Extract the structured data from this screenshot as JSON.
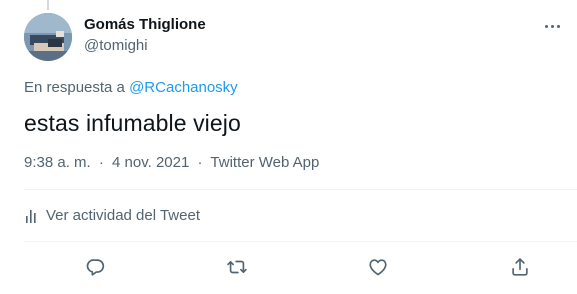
{
  "author": {
    "display_name": "Gomás Thiglione",
    "handle": "@tomighi"
  },
  "reply_context": {
    "prefix": "En respuesta a",
    "mention": "@RCachanosky"
  },
  "tweet": {
    "text": "estas infumable viejo",
    "time": "9:38 a. m.",
    "separator": "·",
    "date": "4 nov. 2021",
    "source": "Twitter Web App"
  },
  "activity": {
    "label": "Ver actividad del Tweet"
  },
  "icons": {
    "more": "more-dots-icon",
    "activity": "bar-chart-icon",
    "reply": "reply-icon",
    "retweet": "retweet-icon",
    "like": "heart-icon",
    "share": "share-icon"
  },
  "colors": {
    "text": "#0f1419",
    "secondary": "#536471",
    "accent": "#1d9bf0",
    "divider": "#eff3f4"
  }
}
